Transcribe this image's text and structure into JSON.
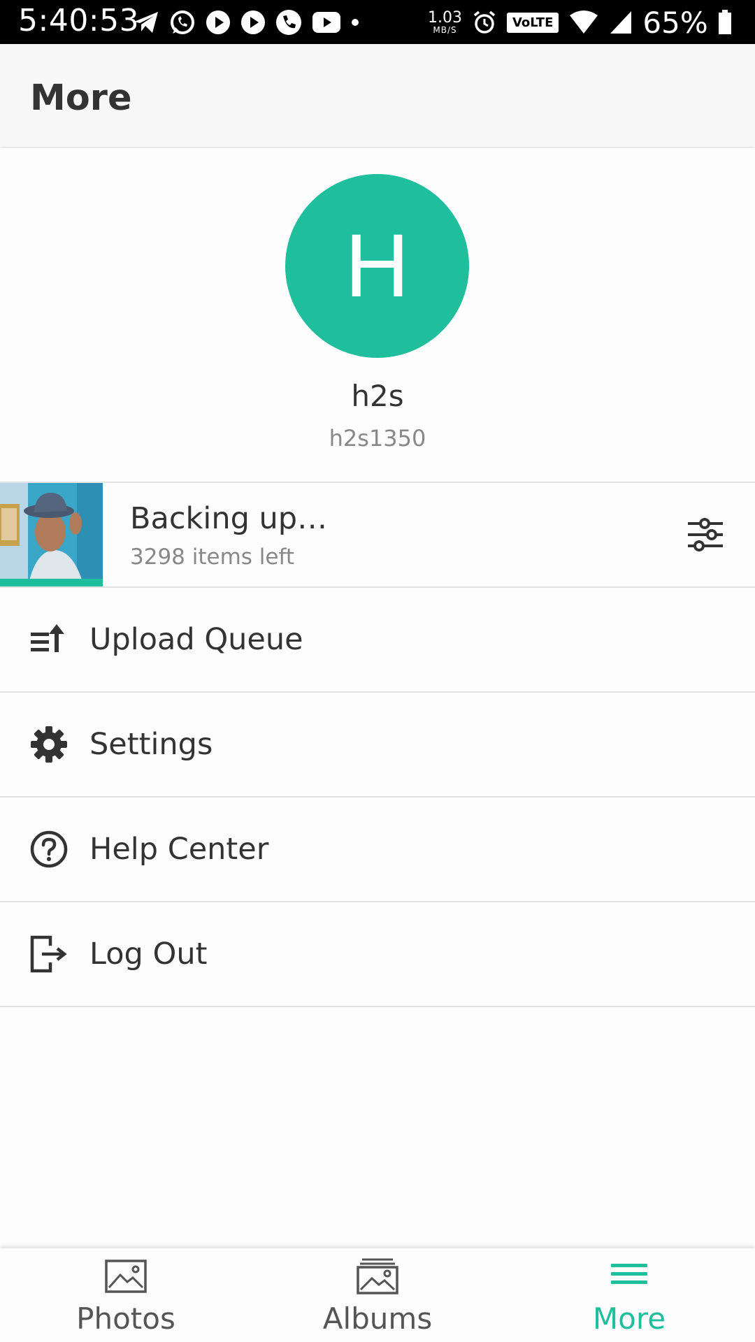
{
  "status_bar": {
    "time": "5:40:53",
    "net_speed_value": "1.03",
    "net_speed_unit": "MB/S",
    "volte": "VoLTE",
    "battery_percent": "65%",
    "left_icons": [
      "telegram-icon",
      "whatsapp-icon",
      "youtube-play-icon",
      "youtube-play-icon",
      "phone-icon",
      "youtube-icon",
      "dot-icon"
    ],
    "right_icons": [
      "alarm-icon",
      "wifi-icon",
      "signal-icon",
      "battery-icon"
    ]
  },
  "app_bar": {
    "title": "More"
  },
  "profile": {
    "avatar_letter": "H",
    "avatar_color": "#1fbe9c",
    "name": "h2s",
    "username": "h2s1350"
  },
  "backup": {
    "title": "Backing up…",
    "subtitle": "3298 items left",
    "progress_color": "#1fbe9c",
    "action_icon": "sliders-icon"
  },
  "menu": {
    "items": [
      {
        "label": "Upload Queue",
        "icon": "upload-queue-icon"
      },
      {
        "label": "Settings",
        "icon": "gear-icon"
      },
      {
        "label": "Help Center",
        "icon": "help-icon"
      },
      {
        "label": "Log Out",
        "icon": "logout-icon"
      }
    ]
  },
  "bottom_nav": {
    "items": [
      {
        "label": "Photos",
        "icon": "photo-icon",
        "active": false
      },
      {
        "label": "Albums",
        "icon": "albums-icon",
        "active": false
      },
      {
        "label": "More",
        "icon": "menu-icon",
        "active": true
      }
    ],
    "active_color": "#1fbe9c"
  }
}
